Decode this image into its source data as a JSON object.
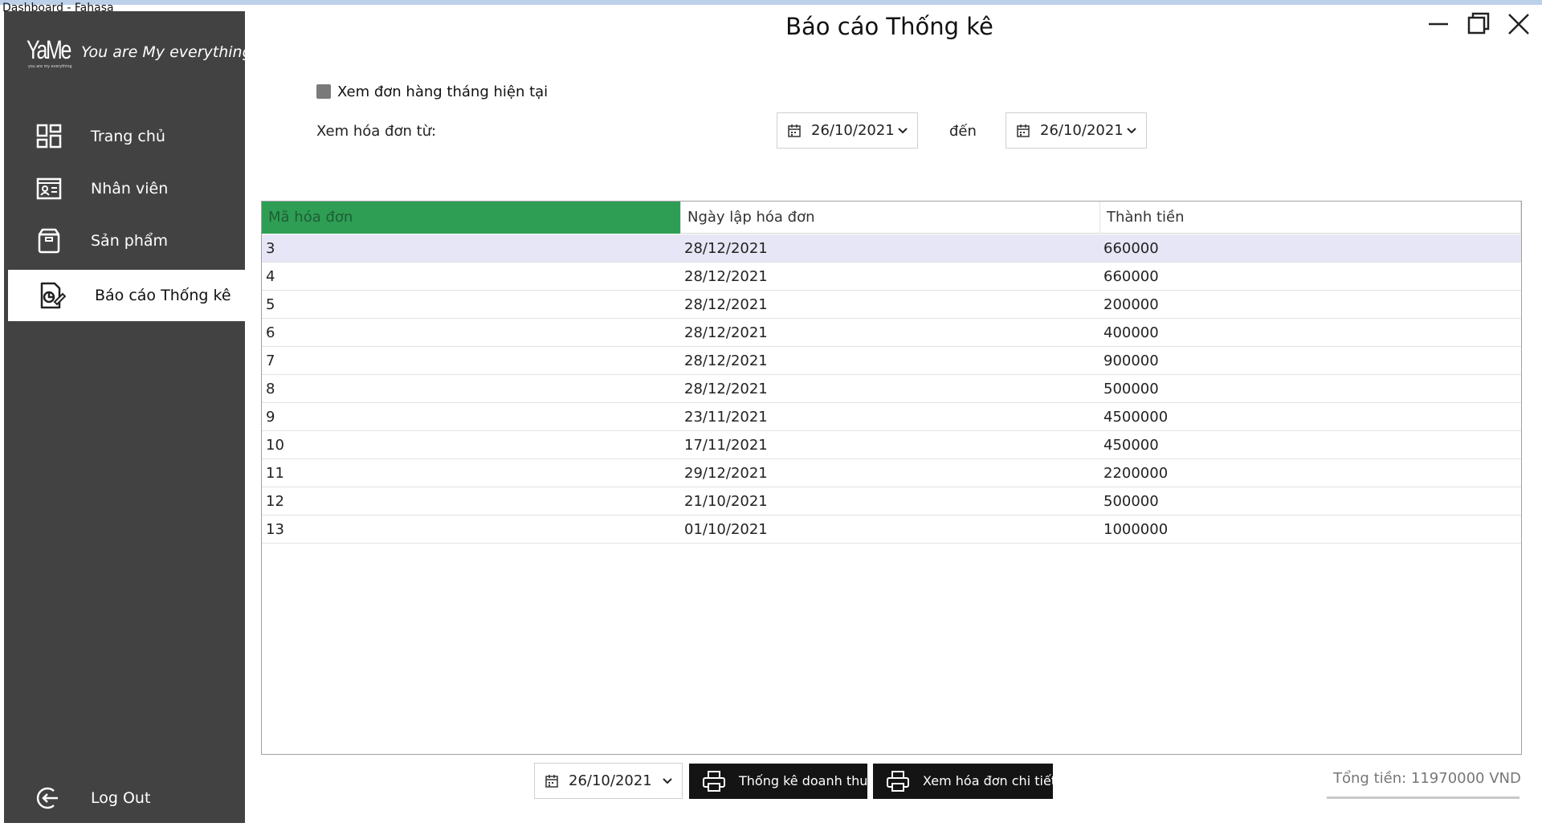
{
  "window": {
    "title": "Dashboard - Fahasa"
  },
  "sidebar": {
    "logo": {
      "text": "YaMe",
      "tagline": "you are my everything"
    },
    "slogan": "You are My everything",
    "items": [
      {
        "label": "Trang chủ",
        "icon": "dashboard-icon"
      },
      {
        "label": "Nhân viên",
        "icon": "employee-card-icon"
      },
      {
        "label": "Sản phẩm",
        "icon": "box-icon"
      },
      {
        "label": "Báo cáo Thống kê",
        "icon": "report-icon",
        "active": true
      }
    ],
    "logout": {
      "label": "Log Out",
      "icon": "logout-icon"
    }
  },
  "header": {
    "title": "Báo cáo Thống kê"
  },
  "filters": {
    "current_month_label": "Xem đơn hàng tháng hiện tại",
    "current_month_checked": false,
    "from_label": "Xem hóa đơn từ:",
    "from_date": "26/10/2021",
    "to_label": "đến",
    "to_date": "26/10/2021"
  },
  "table": {
    "columns": [
      "Mã hóa đơn",
      "Ngày lập hóa đơn",
      "Thành tiền"
    ],
    "rows": [
      [
        "3",
        "28/12/2021",
        "660000"
      ],
      [
        "4",
        "28/12/2021",
        "660000"
      ],
      [
        "5",
        "28/12/2021",
        "200000"
      ],
      [
        "6",
        "28/12/2021",
        "400000"
      ],
      [
        "7",
        "28/12/2021",
        "900000"
      ],
      [
        "8",
        "28/12/2021",
        "500000"
      ],
      [
        "9",
        "23/11/2021",
        "4500000"
      ],
      [
        "10",
        "17/11/2021",
        "450000"
      ],
      [
        "11",
        "29/12/2021",
        "2200000"
      ],
      [
        "12",
        "21/10/2021",
        "500000"
      ],
      [
        "13",
        "01/10/2021",
        "1000000"
      ]
    ]
  },
  "footer": {
    "report_date": "26/10/2021",
    "revenue_button": "Thống kê doanh thu",
    "detail_button": "Xem hóa đơn chi tiết",
    "total": "Tổng tiền: 11970000 VND"
  },
  "colors": {
    "sidebar": "#424242",
    "sorted_header": "#2e9e55",
    "selected_row": "#e6e6f6",
    "button": "#141414"
  }
}
